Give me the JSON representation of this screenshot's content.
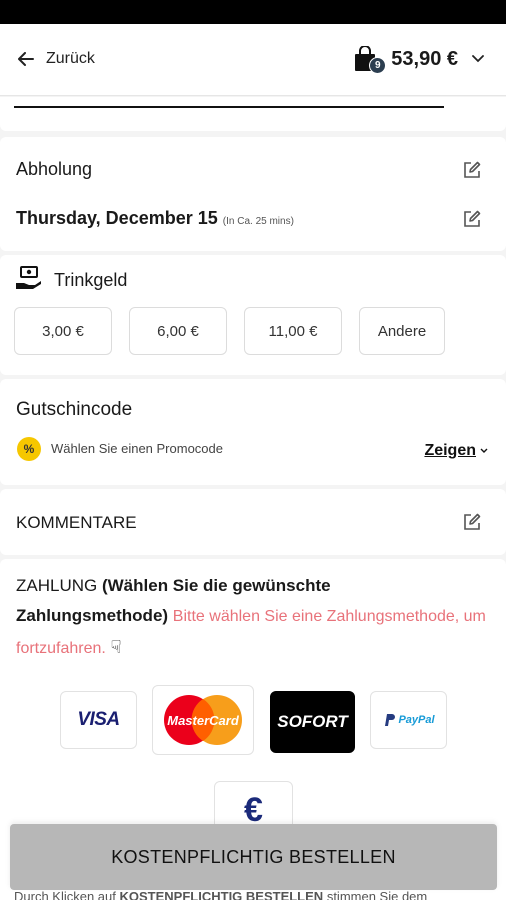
{
  "header": {
    "back_label": "Zurück",
    "cart_count": "9",
    "cart_total": "53,90 €"
  },
  "pickup": {
    "title": "Abholung",
    "date": "Thursday, December 15",
    "eta": "(In Ca. 25 mins)"
  },
  "tip": {
    "title": "Trinkgeld",
    "options": [
      "3,00 €",
      "6,00 €",
      "11,00 €",
      "Andere"
    ]
  },
  "voucher": {
    "title": "Gutschincode",
    "promo_label": "Wählen Sie einen Promocode",
    "show_label": "Zeigen"
  },
  "comments": {
    "title": "KOMMENTARE"
  },
  "payment": {
    "title": "ZAHLUNG",
    "subtitle": "(Wählen Sie die gewünschte Zahlungsmethode)",
    "warning": "Bitte wählen Sie eine Zahlungsmethode, um fortzufahren.",
    "methods": [
      "VISA",
      "MasterCard",
      "SOFORT",
      "PayPal",
      "€"
    ]
  },
  "order_button": "KOSTENPFLICHTIG BESTELLEN",
  "legal": {
    "prefix": "Durch Klicken auf",
    "emph": "KOSTENPFLICHTIG BESTELLEN",
    "suffix": "stimmen Sie dem"
  },
  "colors": {
    "warning": "#e8727a",
    "promo": "#f6c700",
    "button": "#b7b7b7"
  }
}
